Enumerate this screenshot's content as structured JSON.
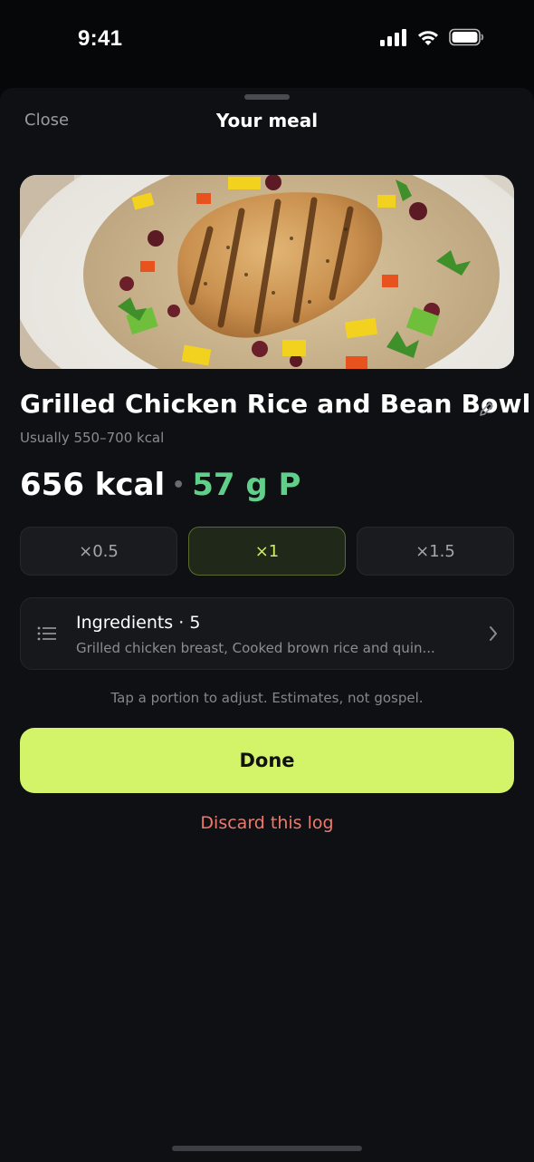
{
  "status_bar": {
    "time": "9:41",
    "icons": [
      "cellular-signal-icon",
      "wifi-icon",
      "battery-icon"
    ]
  },
  "sheet": {
    "close_label": "Close",
    "title": "Your meal"
  },
  "meal": {
    "name": "Grilled Chicken Rice and Bean Bowl",
    "usual_range": "Usually 550–700 kcal",
    "kcal": "656 kcal",
    "separator": "•",
    "protein": "57 g P"
  },
  "portions": [
    {
      "label": "×0.5",
      "selected": false
    },
    {
      "label": "×1",
      "selected": true
    },
    {
      "label": "×1.5",
      "selected": false
    }
  ],
  "ingredients": {
    "title": "Ingredients · 5",
    "summary": "Grilled chicken breast, Cooked brown rice and quin..."
  },
  "hint": "Tap a portion to adjust. Estimates, not gospel.",
  "actions": {
    "done_label": "Done",
    "discard_label": "Discard this log"
  },
  "colors": {
    "accent": "#d3f469",
    "protein": "#5fcf8a",
    "danger": "#ee7a6e",
    "background": "#0f1013"
  }
}
